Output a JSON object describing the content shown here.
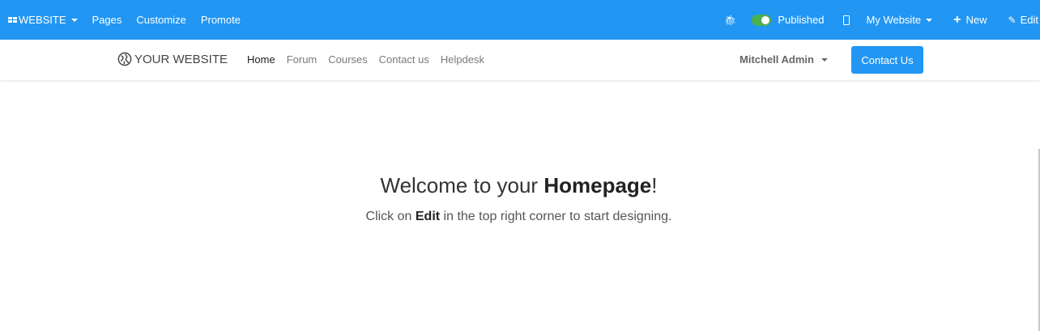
{
  "admin_bar": {
    "apps_label": "WEBSITE",
    "menu": [
      "Pages",
      "Customize",
      "Promote"
    ],
    "published_label": "Published",
    "website_selector": "My Website",
    "new_label": "New",
    "edit_label": "Edit",
    "bg_color": "#2196f3",
    "toggle_color": "#4caf50"
  },
  "navbar": {
    "brand": "YOUR WEBSITE",
    "links": [
      "Home",
      "Forum",
      "Courses",
      "Contact us",
      "Helpdesk"
    ],
    "active_link": "Home",
    "user": "Mitchell Admin",
    "cta": "Contact Us"
  },
  "hero": {
    "title_prefix": "Welcome to your ",
    "title_bold": "Homepage",
    "title_suffix": "!",
    "subtitle_prefix": "Click on ",
    "subtitle_bold": "Edit",
    "subtitle_suffix": " in the top right corner to start designing."
  }
}
